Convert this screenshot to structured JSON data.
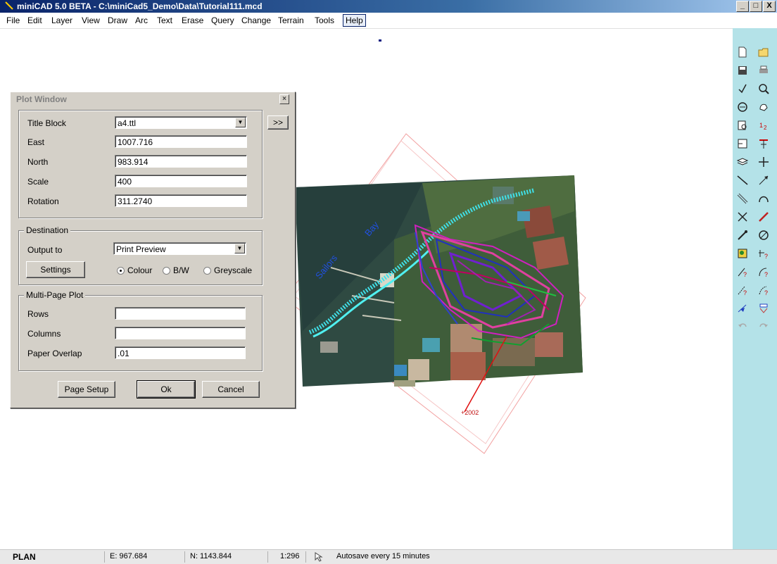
{
  "window": {
    "title": "miniCAD 5.0 BETA - C:\\miniCad5_Demo\\Data\\Tutorial111.mcd",
    "min_label": "_",
    "max_label": "□",
    "close_label": "X"
  },
  "menu": {
    "items": [
      "File",
      "Edit",
      "Layer",
      "View",
      "Draw",
      "Arc",
      "Text",
      "Erase",
      "Query",
      "Change",
      "Terrain",
      "Tools",
      "Help"
    ]
  },
  "plot_window": {
    "title": "Plot Window",
    "close": "×",
    "title_block_label": "Title Block",
    "title_block_value": "a4.ttl",
    "expand_button": ">>",
    "east_label": "East",
    "east_value": "1007.716",
    "north_label": "North",
    "north_value": "983.914",
    "scale_label": "Scale",
    "scale_value": "400",
    "rotation_label": "Rotation",
    "rotation_value": "311.2740",
    "destination_label": "Destination",
    "output_to_label": "Output to",
    "output_to_value": "Print Preview",
    "settings_button": "Settings",
    "colour_label": "Colour",
    "bw_label": "B/W",
    "greyscale_label": "Greyscale",
    "selected_colour_mode": "Colour",
    "multipage_label": "Multi-Page Plot",
    "rows_label": "Rows",
    "rows_value": "",
    "columns_label": "Columns",
    "columns_value": "",
    "overlap_label": "Paper Overlap",
    "overlap_value": ".01",
    "page_setup_button": "Page Setup",
    "ok_button": "Ok",
    "cancel_button": "Cancel"
  },
  "map": {
    "labels": [
      "Sailors",
      "Bay"
    ],
    "point_label": "+2002",
    "frame_color": "#f2a0a0",
    "water_color": "#2e4a4a"
  },
  "status": {
    "mode": "PLAN",
    "east": "E: 967.684",
    "north": "N: 1143.844",
    "scale": "1:296",
    "autosave": "Autosave every 15 minutes"
  },
  "toolbar_right": {
    "background": "#b4e2e8",
    "tools": [
      "new-file-icon",
      "open-folder-icon",
      "save-icon",
      "print-icon",
      "check-icon",
      "zoom-icon",
      "zoom-extents-icon",
      "pan-icon",
      "print-preview-icon",
      "point-number-icon",
      "window-icon",
      "layer-toggle-icon",
      "layers-icon",
      "cross-icon",
      "line-icon",
      "arrow-line-icon",
      "double-line-icon",
      "arc-icon",
      "erase-x-icon",
      "pencil-icon",
      "edit-pen-icon",
      "circle-icon",
      "query-icon",
      "query-point-icon",
      "query-slope-icon",
      "query-arc-icon",
      "query-angle-icon",
      "query-arc2-icon",
      "snap-icon",
      "snap-point-icon",
      "undo-icon",
      "redo-icon"
    ]
  }
}
